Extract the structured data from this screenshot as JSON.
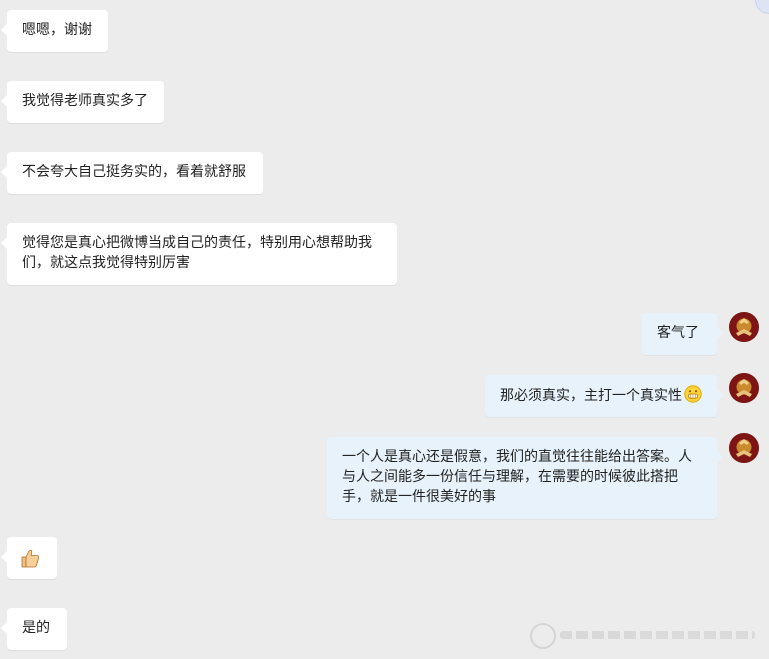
{
  "messages": [
    {
      "side": "in",
      "text": "嗯嗯，谢谢"
    },
    {
      "side": "in",
      "text": "我觉得老师真实多了"
    },
    {
      "side": "in",
      "text": "不会夸大自己挺务实的，看着就舒服"
    },
    {
      "side": "in",
      "text": "觉得您是真心把微博当成自己的责任，特别用心想帮助我们，就这点我觉得特别厉害"
    },
    {
      "side": "out",
      "text": "客气了"
    },
    {
      "side": "out",
      "text": "那必须真实，主打一个真实性"
    },
    {
      "side": "out",
      "text": "一个人是真心还是假意，我们的直觉往往能给出答案。人与人之间能多一份信任与理解，在需要的时候彼此搭把手，就是一件很美好的事"
    },
    {
      "side": "in",
      "text": ""
    },
    {
      "side": "in",
      "text": "是的"
    }
  ],
  "icons": {
    "thumbs_up": "thumbs-up-icon",
    "grin_emoji": "grin-emoji-icon",
    "avatar": "user-avatar-icon"
  },
  "colors": {
    "background": "#ececec",
    "incoming_bubble": "#ffffff",
    "outgoing_bubble": "#e7f2fb",
    "text": "#222222",
    "avatar_red": "#7f1415",
    "avatar_gold": "#c98b2e"
  }
}
